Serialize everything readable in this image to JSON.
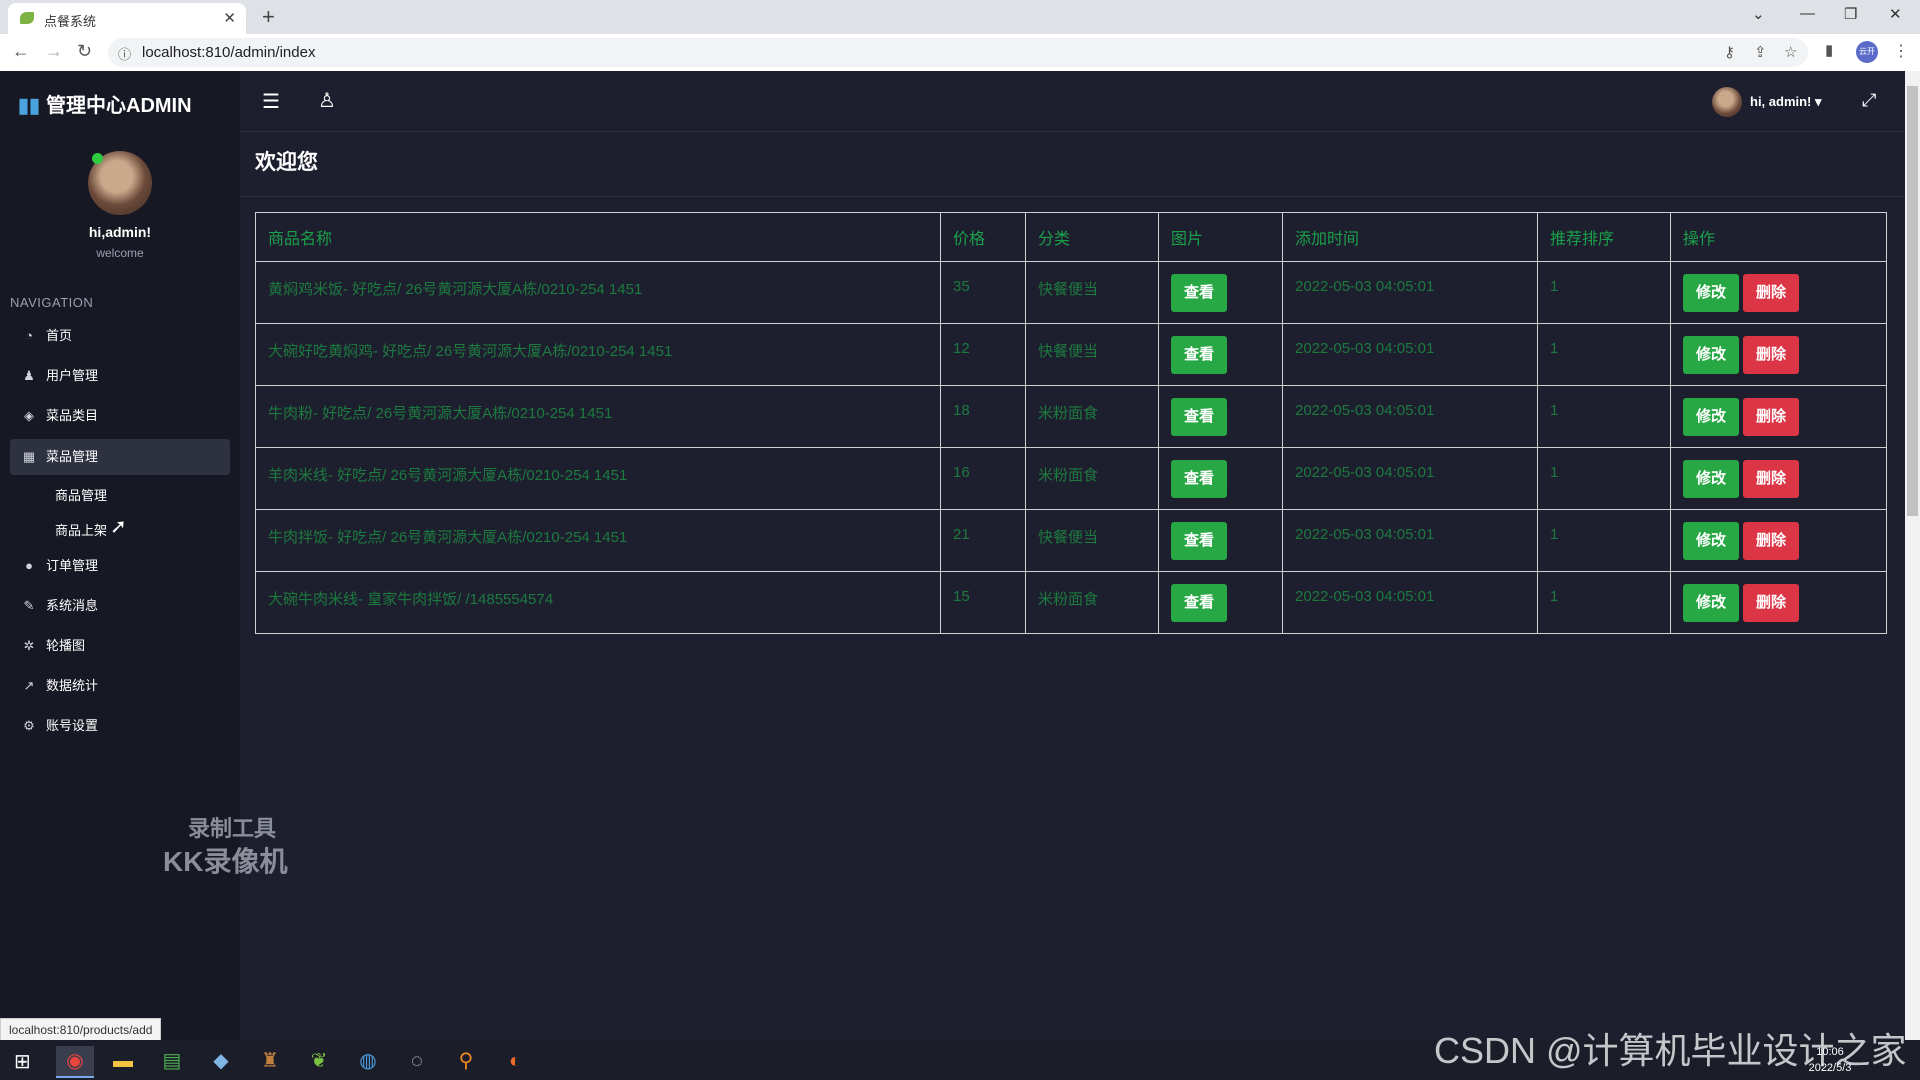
{
  "browser": {
    "tab_title": "点餐系统",
    "url": "localhost:810/admin/index",
    "profile_label": "云开",
    "status_url": "localhost:810/products/add"
  },
  "sidebar": {
    "brand": "管理中心ADMIN",
    "user_name": "hi,admin!",
    "user_sub": "welcome",
    "nav_heading": "NAVIGATION",
    "items": [
      {
        "label": "首页",
        "icon": "dashboard-icon"
      },
      {
        "label": "用户管理",
        "icon": "user-icon"
      },
      {
        "label": "菜品类目",
        "icon": "cube-icon"
      },
      {
        "label": "菜品管理",
        "icon": "grid-icon"
      },
      {
        "label": "订单管理",
        "icon": "circle-icon"
      },
      {
        "label": "系统消息",
        "icon": "edit-icon"
      },
      {
        "label": "轮播图",
        "icon": "spinner-icon"
      },
      {
        "label": "数据统计",
        "icon": "chart-icon"
      },
      {
        "label": "账号设置",
        "icon": "gear-icon"
      }
    ],
    "sub_items": [
      "商品管理",
      "商品上架"
    ],
    "watermark_line1": "录制工具",
    "watermark_line2": "KK录像机"
  },
  "header": {
    "user_label": "hi, admin! ▾"
  },
  "main": {
    "title": "欢迎您",
    "table": {
      "headers": [
        "商品名称",
        "价格",
        "分类",
        "图片",
        "添加时间",
        "推荐排序",
        "操作"
      ],
      "view_label": "查看",
      "edit_label": "修改",
      "delete_label": "删除",
      "rows": [
        {
          "name": "黄焖鸡米饭- 好吃点/ 26号黄河源大厦A栋/0210-254 1451",
          "price": "35",
          "category": "快餐便当",
          "time": "2022-05-03 04:05:01",
          "sort": "1"
        },
        {
          "name": "大碗好吃黄焖鸡- 好吃点/ 26号黄河源大厦A栋/0210-254 1451",
          "price": "12",
          "category": "快餐便当",
          "time": "2022-05-03 04:05:01",
          "sort": "1"
        },
        {
          "name": "牛肉粉- 好吃点/ 26号黄河源大厦A栋/0210-254 1451",
          "price": "18",
          "category": "米粉面食",
          "time": "2022-05-03 04:05:01",
          "sort": "1"
        },
        {
          "name": "羊肉米线- 好吃点/ 26号黄河源大厦A栋/0210-254 1451",
          "price": "16",
          "category": "米粉面食",
          "time": "2022-05-03 04:05:01",
          "sort": "1"
        },
        {
          "name": "牛肉拌饭- 好吃点/ 26号黄河源大厦A栋/0210-254 1451",
          "price": "21",
          "category": "快餐便当",
          "time": "2022-05-03 04:05:01",
          "sort": "1"
        },
        {
          "name": "大碗牛肉米线- 皇家牛肉拌饭/ /1485554574",
          "price": "15",
          "category": "米粉面食",
          "time": "2022-05-03 04:05:01",
          "sort": "1"
        }
      ]
    }
  },
  "taskbar": {
    "time": "10:06",
    "date": "2022/5/3"
  },
  "overlay": {
    "csdn": "CSDN @计算机毕业设计之家"
  }
}
